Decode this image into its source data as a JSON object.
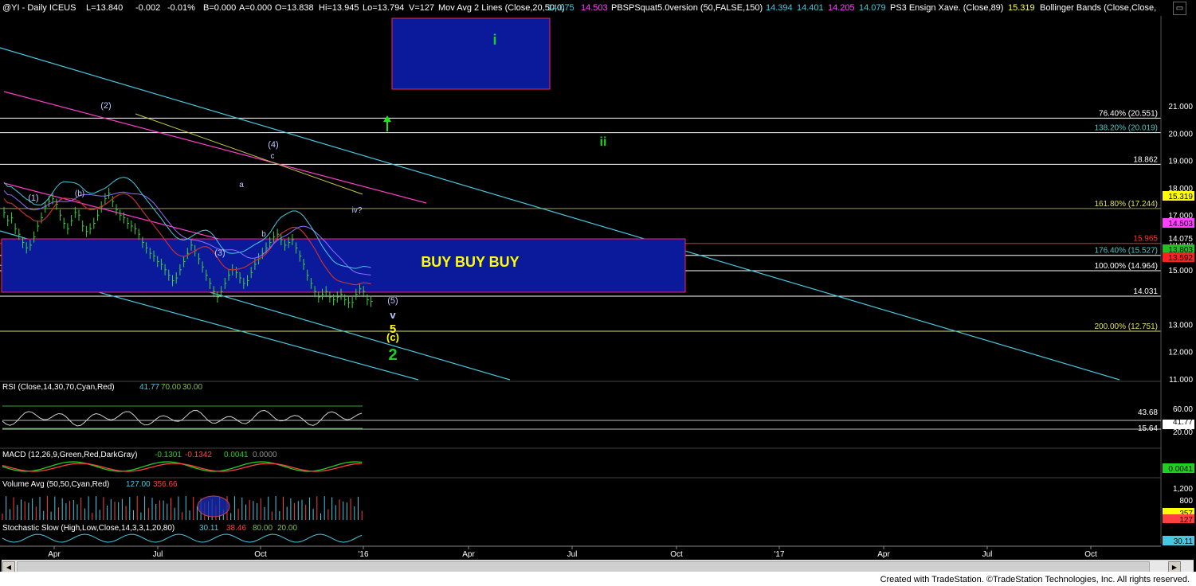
{
  "colors": {
    "background": "#000000",
    "price_bars": "#3cd23c",
    "buy_box": "#0a1a9a",
    "trendline": "#48c8e0",
    "pink": "#ff3cc8",
    "hline": "#ffffff",
    "red_line": "#e03030",
    "label_teal": "#48c8c8"
  },
  "header": {
    "symbol": "@YI - Daily ICEUS",
    "last": "L=13.840",
    "change": "-0.002",
    "pct": "-0.01%",
    "bid": "B=0.000",
    "ask": "A=0.000",
    "open": "O=13.838",
    "high": "Hi=13.945",
    "low": "Lo=13.794",
    "vol": "V=127",
    "ma_name": "Mov Avg 2 Lines (Close,20,50,0)",
    "ma1": "14.075",
    "ma2": "14.503",
    "pbs_name": "PBSPSquat5.0version (50,FALSE,150)",
    "pbs1": "14.394",
    "pbs2": "14.401",
    "pbs3": "14.205",
    "pbs4": "14.079",
    "ps3_name": "PS3 Ensign Xave. (Close,89)",
    "ps3": "15.319",
    "bb_name": "Bollinger Bands (Close,Close,"
  },
  "chart_data": {
    "type": "line",
    "title": "@YI - Daily ICEUS",
    "x_tick_labels": [
      "Apr",
      "Jul",
      "Oct",
      "'16",
      "Apr",
      "Jul",
      "Oct",
      "'17",
      "Apr",
      "Jul",
      "Oct"
    ],
    "y_tick_labels": [
      "21.000",
      "20.000",
      "19.000",
      "18.000",
      "17.000",
      "16.000",
      "15.000",
      "13.000",
      "12.000",
      "11.000"
    ],
    "ylim": [
      10.7,
      21.6
    ],
    "price_series": {
      "name": "@YI Daily",
      "values": [
        17.1,
        16.8,
        16.9,
        16.5,
        16.3,
        16.0,
        15.8,
        15.9,
        16.2,
        16.6,
        16.9,
        17.3,
        17.5,
        17.6,
        17.4,
        17.0,
        16.7,
        16.5,
        16.8,
        17.1,
        17.0,
        16.6,
        16.4,
        16.5,
        16.7,
        17.0,
        17.3,
        17.6,
        17.8,
        17.5,
        17.2,
        17.0,
        16.9,
        16.7,
        16.6,
        16.5,
        16.3,
        16.0,
        15.8,
        15.6,
        15.5,
        15.3,
        15.2,
        15.0,
        14.8,
        14.6,
        14.7,
        15.0,
        15.3,
        15.6,
        15.9,
        15.7,
        15.4,
        15.1,
        14.8,
        14.5,
        14.2,
        14.0,
        14.2,
        14.5,
        14.8,
        15.0,
        14.9,
        14.7,
        14.5,
        14.6,
        14.9,
        15.2,
        15.4,
        15.6,
        15.8,
        16.0,
        16.2,
        16.3,
        16.1,
        15.9,
        16.0,
        16.1,
        15.8,
        15.5,
        15.2,
        14.8,
        14.5,
        14.2,
        14.0,
        14.1,
        14.2,
        14.0,
        13.9,
        14.0,
        14.1,
        13.9,
        13.8,
        13.8,
        14.1,
        14.3,
        14.2,
        13.9,
        13.84
      ]
    },
    "horizontal_levels": [
      {
        "label": "76.40% (20.551)",
        "value": 20.551
      },
      {
        "label": "138.20% (20.019)",
        "value": 20.019
      },
      {
        "label": "18.862",
        "value": 18.862
      },
      {
        "label": "161.80% (17.244)",
        "value": 17.244
      },
      {
        "label": "15.965",
        "value": 15.965
      },
      {
        "label": "176.40% (15.527)",
        "value": 15.527
      },
      {
        "label": "100.00% (14.964)",
        "value": 14.964
      },
      {
        "label": "14.031",
        "value": 14.031
      },
      {
        "label": "200.00% (12.751)",
        "value": 12.751
      }
    ],
    "price_badges": [
      {
        "text": "15.319",
        "value": 15.319,
        "bg": "#ffff00",
        "fg": "#000000"
      },
      {
        "text": "14.503",
        "value": 14.503,
        "bg": "#ff40ff",
        "fg": "#000000"
      },
      {
        "text": "14.075",
        "value": 14.075,
        "bg": "#000000",
        "fg": "#ffffff"
      },
      {
        "text": "13.803",
        "value": 13.803,
        "bg": "#20c020",
        "fg": "#000000"
      },
      {
        "text": "13.592",
        "value": 13.592,
        "bg": "#ff2020",
        "fg": "#000000"
      }
    ],
    "wave_labels": [
      "(1)",
      "(2)",
      "(3)",
      "(4)",
      "(5)",
      "(b)",
      "a",
      "b",
      "c",
      "iv?",
      "v",
      "5",
      "(c)",
      "2",
      "i",
      "ii"
    ],
    "annotation": "BUY BUY BUY",
    "indicators": {
      "rsi": {
        "label": "RSI (Close,14,30,70,Cyan,Red)",
        "value": "41.77",
        "ob": "70.00",
        "os": "30.00",
        "levels": [
          "60.00",
          "43.68",
          "41.77",
          "20.00",
          "15.64"
        ]
      },
      "macd": {
        "label": "MACD (12,26,9,Green,Red,DarkGray)",
        "macd": "-0.1301",
        "signal": "-0.1342",
        "diff": "0.0041",
        "zero": "0.0000",
        "badge": "0.0041"
      },
      "volume": {
        "label": "Volume Avg (50,50,Cyan,Red)",
        "vol": "127.00",
        "avg": "356.66",
        "levels": [
          "1,200",
          "800",
          "357",
          "127"
        ]
      },
      "stochastic": {
        "label": "Stochastic Slow (High,Low,Close,14,3,3,1,20,80)",
        "k": "30.11",
        "d": "38.46",
        "ob": "80.00",
        "os": "20.00",
        "badge": "30.11"
      }
    }
  },
  "footer": {
    "credit": "Created with TradeStation. ©TradeStation Technologies, Inc. All rights reserved."
  }
}
